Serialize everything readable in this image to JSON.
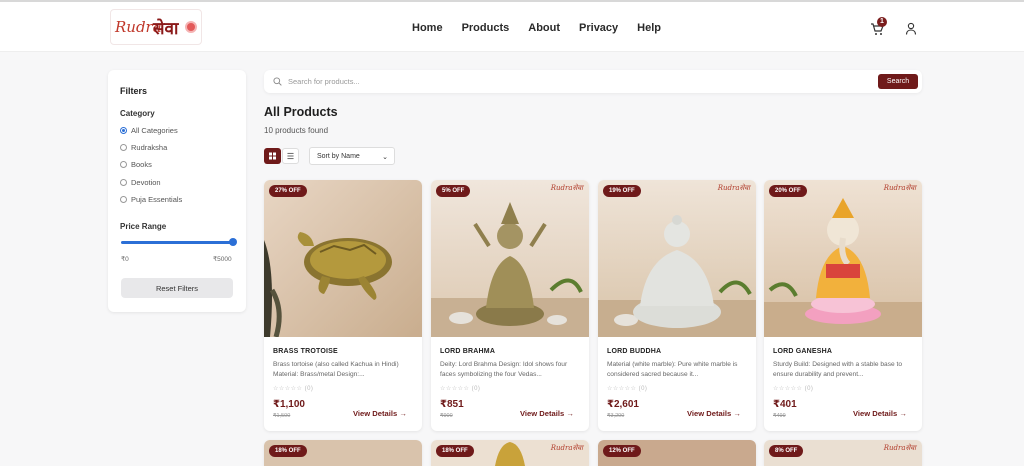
{
  "header": {
    "logo_script": "Rudra",
    "logo_devanagari": "सेवा",
    "nav": [
      "Home",
      "Products",
      "About",
      "Privacy",
      "Help"
    ],
    "cart_count": "1"
  },
  "filters": {
    "title": "Filters",
    "category_label": "Category",
    "categories": [
      "All Categories",
      "Rudraksha",
      "Books",
      "Devotion",
      "Puja Essentials"
    ],
    "selected_category": "All Categories",
    "price_label": "Price Range",
    "price_min": "₹0",
    "price_max": "₹5000",
    "reset_label": "Reset Filters"
  },
  "search": {
    "placeholder": "Search for products...",
    "button": "Search"
  },
  "main": {
    "title": "All Products",
    "count": "10 products found",
    "sort": "Sort by Name"
  },
  "products": [
    {
      "badge": "27% OFF",
      "name": "BRASS TROTOISE",
      "desc": "Brass tortoise (also called Kachua in Hindi) Material: Brass/metal Design:...",
      "reviews": "(0)",
      "price": "₹1,100",
      "mrp": "₹1,500",
      "cta": "View Details",
      "watermark": ""
    },
    {
      "badge": "5% OFF",
      "name": "LORD BRAHMA",
      "desc": "Deity: Lord Brahma Design: Idol shows four faces symbolizing the four Vedas...",
      "reviews": "(0)",
      "price": "₹851",
      "mrp": "₹900",
      "cta": "View Details",
      "watermark": "Rudraसेवा"
    },
    {
      "badge": "19% OFF",
      "name": "LORD BUDDHA",
      "desc": "Material (white marble): Pure white marble is considered sacred because it...",
      "reviews": "(0)",
      "price": "₹2,601",
      "mrp": "₹3,200",
      "cta": "View Details",
      "watermark": "Rudraसेवा"
    },
    {
      "badge": "20% OFF",
      "name": "LORD GANESHA",
      "desc": "Sturdy Build: Designed with a stable base to ensure durability and prevent...",
      "reviews": "(0)",
      "price": "₹401",
      "mrp": "₹499",
      "cta": "View Details",
      "watermark": "Rudraसेवा"
    },
    {
      "badge": "18% OFF",
      "watermark": ""
    },
    {
      "badge": "18% OFF",
      "watermark": "Rudraसेवा"
    },
    {
      "badge": "12% OFF",
      "watermark": ""
    },
    {
      "badge": "8% OFF",
      "watermark": "Rudraसेवा"
    }
  ]
}
